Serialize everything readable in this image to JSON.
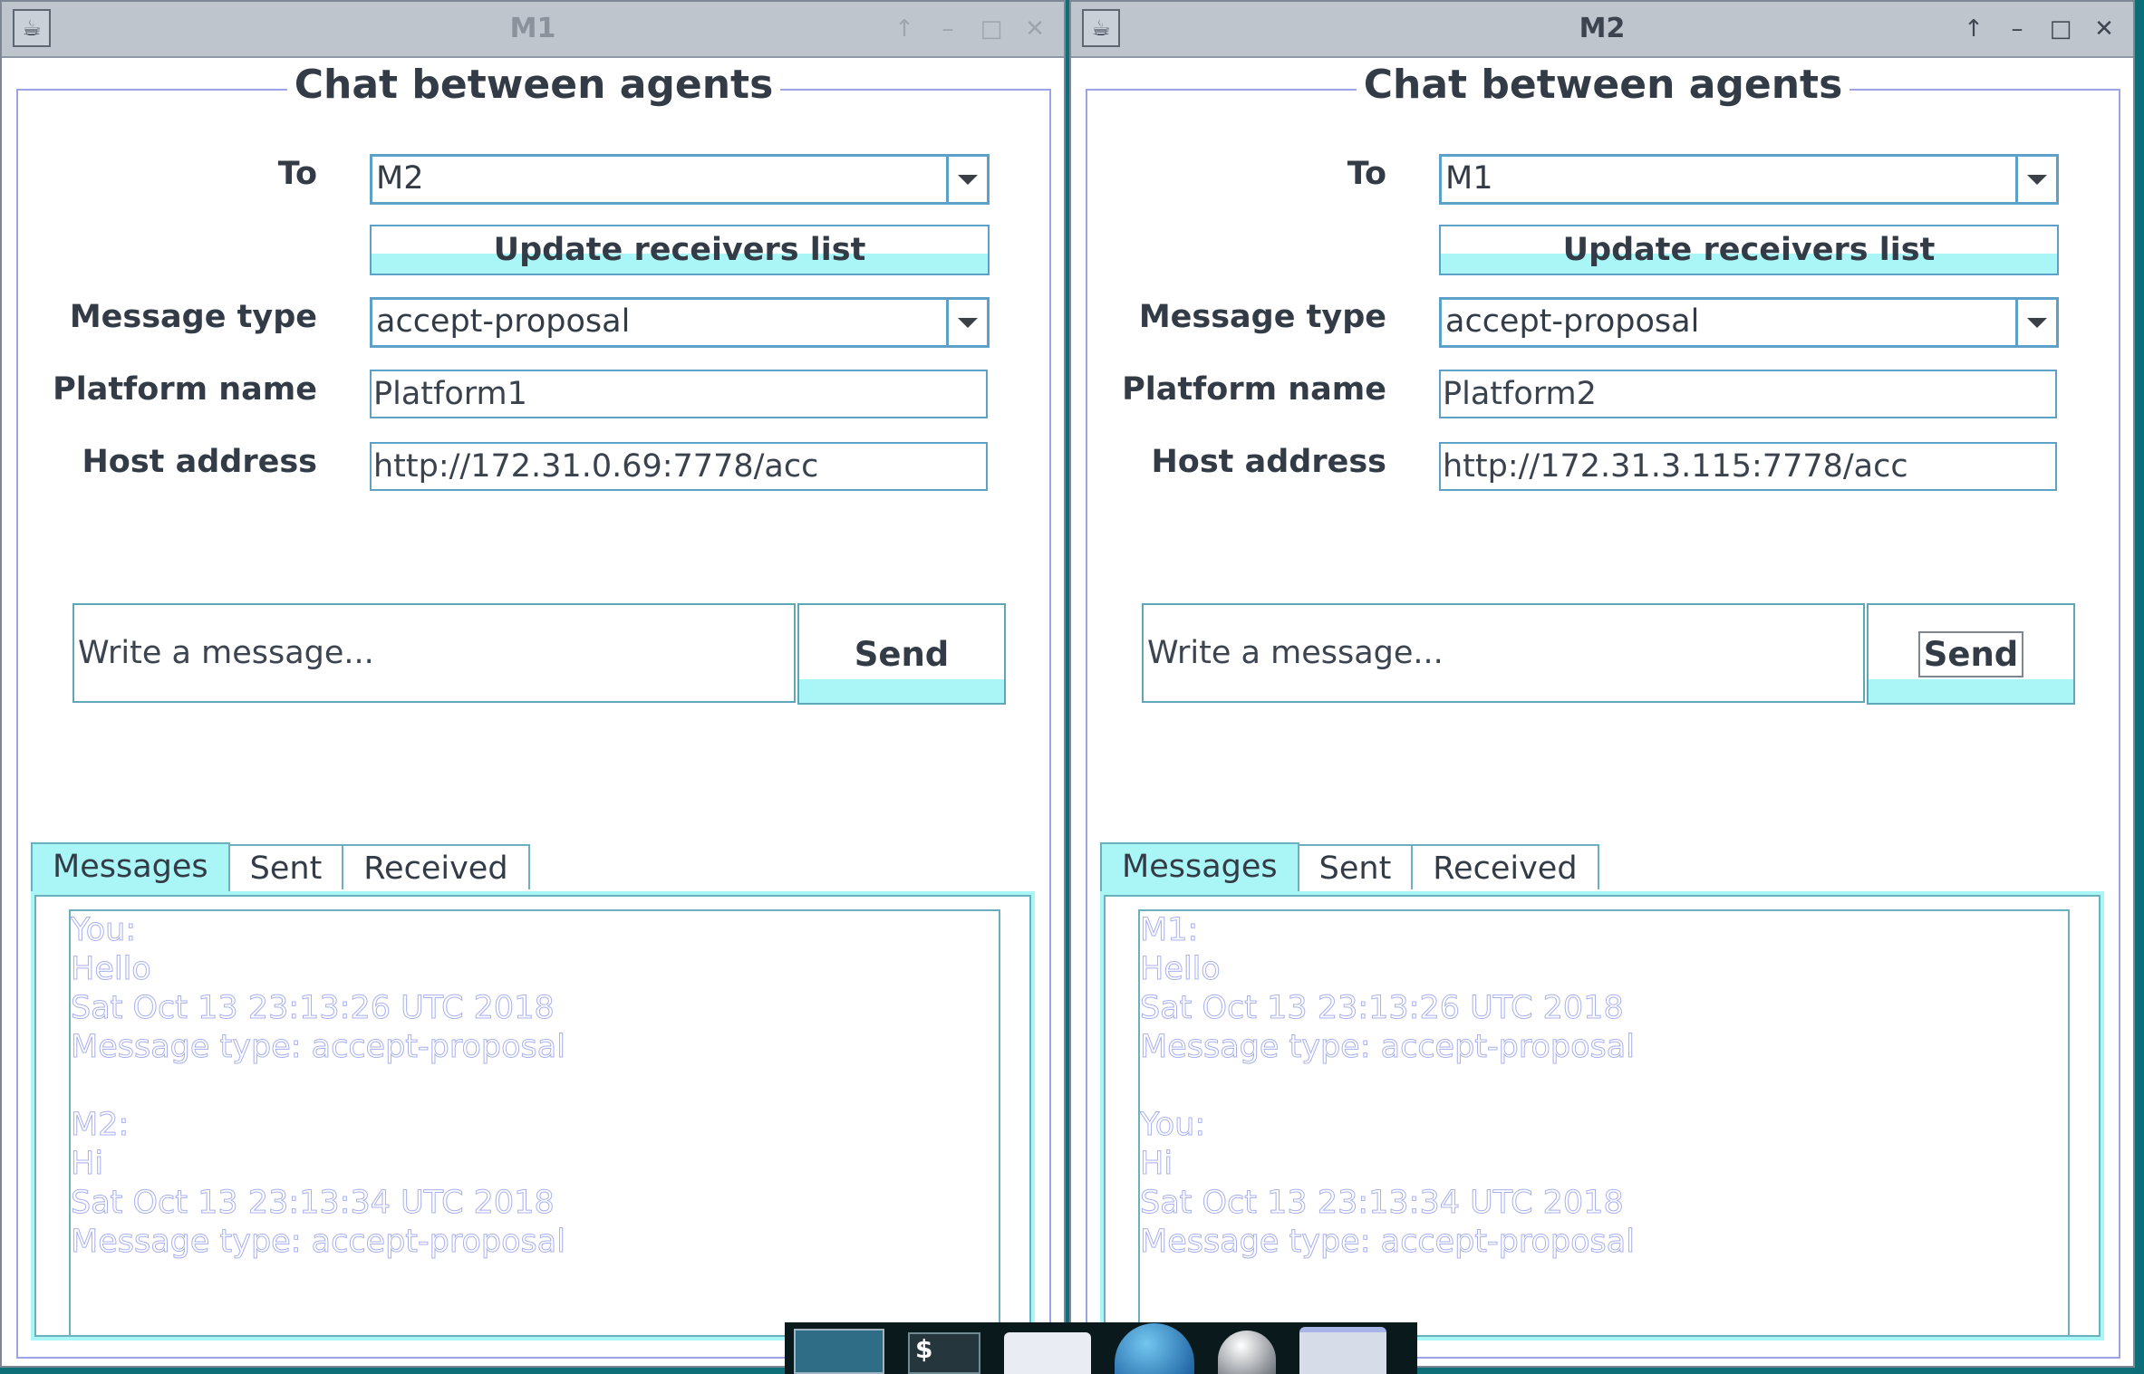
{
  "windows": [
    {
      "title": "M1",
      "panel_title": "Chat between agents",
      "labels": {
        "to": "To",
        "message_type": "Message type",
        "platform_name": "Platform name",
        "host_address": "Host address"
      },
      "to_value": "M2",
      "update_button": "Update receivers list",
      "message_type_value": "accept-proposal",
      "platform_name_value": "Platform1",
      "host_address_value": "http://172.31.0.69:7778/acc",
      "message_placeholder": "Write a message...",
      "send_label": "Send",
      "tabs": [
        "Messages",
        "Sent",
        "Received"
      ],
      "messages": [
        "You:",
        "Hello",
        "Sat Oct 13 23:13:26 UTC 2018",
        "Message type: accept-proposal",
        "",
        "M2:",
        "Hi",
        "Sat Oct 13 23:13:34 UTC 2018",
        "Message type: accept-proposal"
      ]
    },
    {
      "title": "M2",
      "panel_title": "Chat between agents",
      "labels": {
        "to": "To",
        "message_type": "Message type",
        "platform_name": "Platform name",
        "host_address": "Host address"
      },
      "to_value": "M1",
      "update_button": "Update receivers list",
      "message_type_value": "accept-proposal",
      "platform_name_value": "Platform2",
      "host_address_value": "http://172.31.3.115:7778/acc",
      "message_placeholder": "Write a message...",
      "send_label": "Send",
      "tabs": [
        "Messages",
        "Sent",
        "Received"
      ],
      "messages": [
        "M1:",
        "Hello",
        "Sat Oct 13 23:13:26 UTC 2018",
        "Message type: accept-proposal",
        "",
        "You:",
        "Hi",
        "Sat Oct 13 23:13:34 UTC 2018",
        "Message type: accept-proposal"
      ]
    }
  ],
  "taskbar": {
    "icons": [
      "window-icon",
      "terminal-icon",
      "folder-icon",
      "globe-icon",
      "ball-icon",
      "folder-icon"
    ],
    "terminal_glyph": "$"
  },
  "colors": {
    "desktop": "#0e6f78",
    "accent": "#aaf6f6",
    "border": "#5da0c8",
    "message_text_outline": "#a9b0ee"
  }
}
